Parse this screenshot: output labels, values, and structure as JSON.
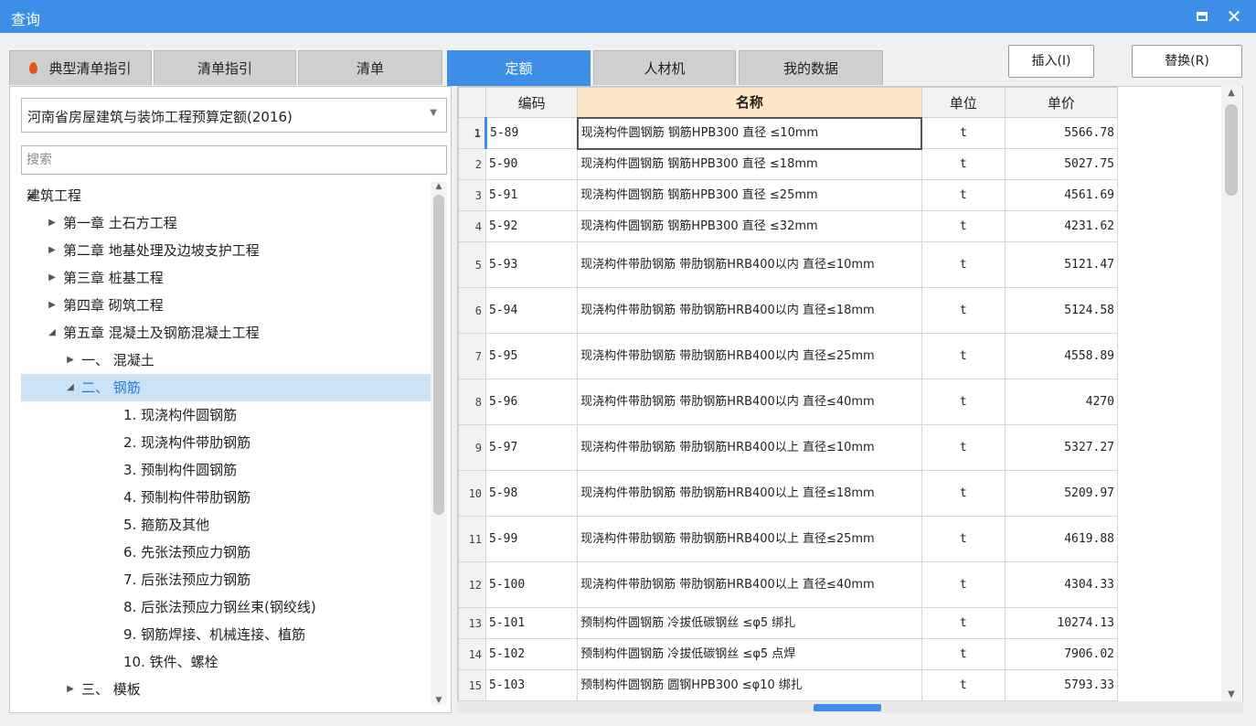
{
  "window": {
    "title": "查询"
  },
  "tabs": [
    {
      "label": "典型清单指引",
      "fire_icon": true
    },
    {
      "label": "清单指引"
    },
    {
      "label": "清单"
    },
    {
      "label": "定额",
      "active": true
    },
    {
      "label": "人材机"
    },
    {
      "label": "我的数据"
    }
  ],
  "actions": {
    "insert": "插入(I)",
    "replace": "替换(R)"
  },
  "quota_selector": {
    "value": "河南省房屋建筑与装饰工程预算定额(2016)"
  },
  "search": {
    "placeholder": "搜索"
  },
  "tree": [
    {
      "label": "建筑工程",
      "level": 0,
      "expander": "expanded"
    },
    {
      "label": "第一章 土石方工程",
      "level": 1,
      "expander": "collapsed"
    },
    {
      "label": "第二章 地基处理及边坡支护工程",
      "level": 1,
      "expander": "collapsed"
    },
    {
      "label": "第三章 桩基工程",
      "level": 1,
      "expander": "collapsed"
    },
    {
      "label": "第四章 砌筑工程",
      "level": 1,
      "expander": "collapsed"
    },
    {
      "label": "第五章 混凝土及钢筋混凝土工程",
      "level": 1,
      "expander": "expanded"
    },
    {
      "label": "一、 混凝土",
      "level": 2,
      "expander": "collapsed"
    },
    {
      "label": "二、 钢筋",
      "level": 2,
      "expander": "expanded",
      "selected": true
    },
    {
      "label": "1. 现浇构件圆钢筋",
      "level": 3,
      "expander": "none"
    },
    {
      "label": "2. 现浇构件带肋钢筋",
      "level": 3,
      "expander": "none"
    },
    {
      "label": "3. 预制构件圆钢筋",
      "level": 3,
      "expander": "none"
    },
    {
      "label": "4. 预制构件带肋钢筋",
      "level": 3,
      "expander": "none"
    },
    {
      "label": "5. 箍筋及其他",
      "level": 3,
      "expander": "none"
    },
    {
      "label": "6. 先张法预应力钢筋",
      "level": 3,
      "expander": "none"
    },
    {
      "label": "7. 后张法预应力钢筋",
      "level": 3,
      "expander": "none"
    },
    {
      "label": "8. 后张法预应力钢丝束(钢绞线)",
      "level": 3,
      "expander": "none"
    },
    {
      "label": "9. 钢筋焊接、机械连接、植筋",
      "level": 3,
      "expander": "none"
    },
    {
      "label": "10. 铁件、螺栓",
      "level": 3,
      "expander": "none"
    },
    {
      "label": "三、 模板",
      "level": 2,
      "expander": "collapsed"
    }
  ],
  "grid": {
    "columns": {
      "code": "编码",
      "name": "名称",
      "unit": "单位",
      "price": "单价"
    },
    "rows": [
      {
        "no": "1",
        "code": "5-89",
        "name": "现浇构件圆钢筋 钢筋HPB300 直径 ≤10mm",
        "unit": "t",
        "price": "5566.78",
        "current": true
      },
      {
        "no": "2",
        "code": "5-90",
        "name": "现浇构件圆钢筋 钢筋HPB300 直径 ≤18mm",
        "unit": "t",
        "price": "5027.75"
      },
      {
        "no": "3",
        "code": "5-91",
        "name": "现浇构件圆钢筋 钢筋HPB300 直径 ≤25mm",
        "unit": "t",
        "price": "4561.69"
      },
      {
        "no": "4",
        "code": "5-92",
        "name": "现浇构件圆钢筋 钢筋HPB300 直径 ≤32mm",
        "unit": "t",
        "price": "4231.62"
      },
      {
        "no": "5",
        "code": "5-93",
        "name": "现浇构件带肋钢筋 带肋钢筋HRB400以内 直径≤10mm",
        "unit": "t",
        "price": "5121.47"
      },
      {
        "no": "6",
        "code": "5-94",
        "name": "现浇构件带肋钢筋 带肋钢筋HRB400以内 直径≤18mm",
        "unit": "t",
        "price": "5124.58"
      },
      {
        "no": "7",
        "code": "5-95",
        "name": "现浇构件带肋钢筋 带肋钢筋HRB400以内 直径≤25mm",
        "unit": "t",
        "price": "4558.89"
      },
      {
        "no": "8",
        "code": "5-96",
        "name": "现浇构件带肋钢筋 带肋钢筋HRB400以内 直径≤40mm",
        "unit": "t",
        "price": "4270"
      },
      {
        "no": "9",
        "code": "5-97",
        "name": "现浇构件带肋钢筋 带肋钢筋HRB400以上 直径≤10mm",
        "unit": "t",
        "price": "5327.27"
      },
      {
        "no": "10",
        "code": "5-98",
        "name": "现浇构件带肋钢筋 带肋钢筋HRB400以上 直径≤18mm",
        "unit": "t",
        "price": "5209.97"
      },
      {
        "no": "11",
        "code": "5-99",
        "name": "现浇构件带肋钢筋 带肋钢筋HRB400以上 直径≤25mm",
        "unit": "t",
        "price": "4619.88"
      },
      {
        "no": "12",
        "code": "5-100",
        "name": "现浇构件带肋钢筋 带肋钢筋HRB400以上 直径≤40mm",
        "unit": "t",
        "price": "4304.33"
      },
      {
        "no": "13",
        "code": "5-101",
        "name": "预制构件圆钢筋 冷拔低碳钢丝 ≤φ5 绑扎",
        "unit": "t",
        "price": "10274.13"
      },
      {
        "no": "14",
        "code": "5-102",
        "name": "预制构件圆钢筋 冷拔低碳钢丝 ≤φ5 点焊",
        "unit": "t",
        "price": "7906.02"
      },
      {
        "no": "15",
        "code": "5-103",
        "name": "预制构件圆钢筋 圆钢HPB300 ≤φ10 绑扎",
        "unit": "t",
        "price": "5793.33"
      }
    ]
  },
  "colors": {
    "accent": "#3d8ee6",
    "header_highlight": "#fde7c8",
    "selection": "#cbe3f7"
  }
}
